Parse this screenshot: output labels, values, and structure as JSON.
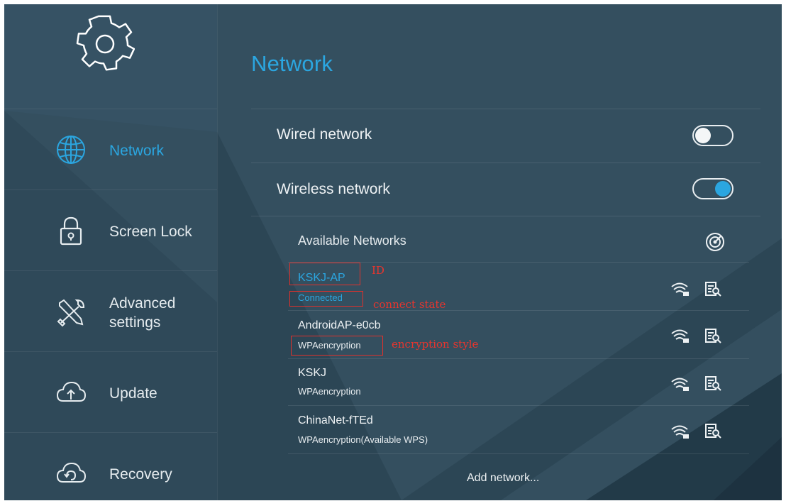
{
  "page": {
    "title": "Network"
  },
  "sidebar": {
    "items": [
      {
        "label": "Network",
        "icon": "globe-icon",
        "active": true
      },
      {
        "label": "Screen Lock",
        "icon": "lock-icon",
        "active": false
      },
      {
        "label_line1": "Advanced",
        "label_line2": "settings",
        "icon": "tools-icon",
        "active": false
      },
      {
        "label": "Update",
        "icon": "cloud-upload-icon",
        "active": false
      },
      {
        "label": "Recovery",
        "icon": "cloud-restore-icon",
        "active": false
      }
    ]
  },
  "main": {
    "wired": {
      "label": "Wired network",
      "enabled": false
    },
    "wireless": {
      "label": "Wireless network",
      "enabled": true
    },
    "available_label": "Available Networks",
    "networks": [
      {
        "name": "KSKJ-AP",
        "status": "Connected"
      },
      {
        "name": "AndroidAP-e0cb",
        "status": "WPAencryption"
      },
      {
        "name": "KSKJ",
        "status": "WPAencryption"
      },
      {
        "name": "ChinaNet-fTEd",
        "status": "WPAencryption(Available WPS)"
      }
    ],
    "add_network": "Add network..."
  },
  "annotations": {
    "id": "ID",
    "connect_state": "connect state",
    "encryption_style": "encryption style"
  },
  "colors": {
    "background": "#344f5f",
    "accent": "#2ba6e0",
    "annotation": "#e0312c"
  }
}
